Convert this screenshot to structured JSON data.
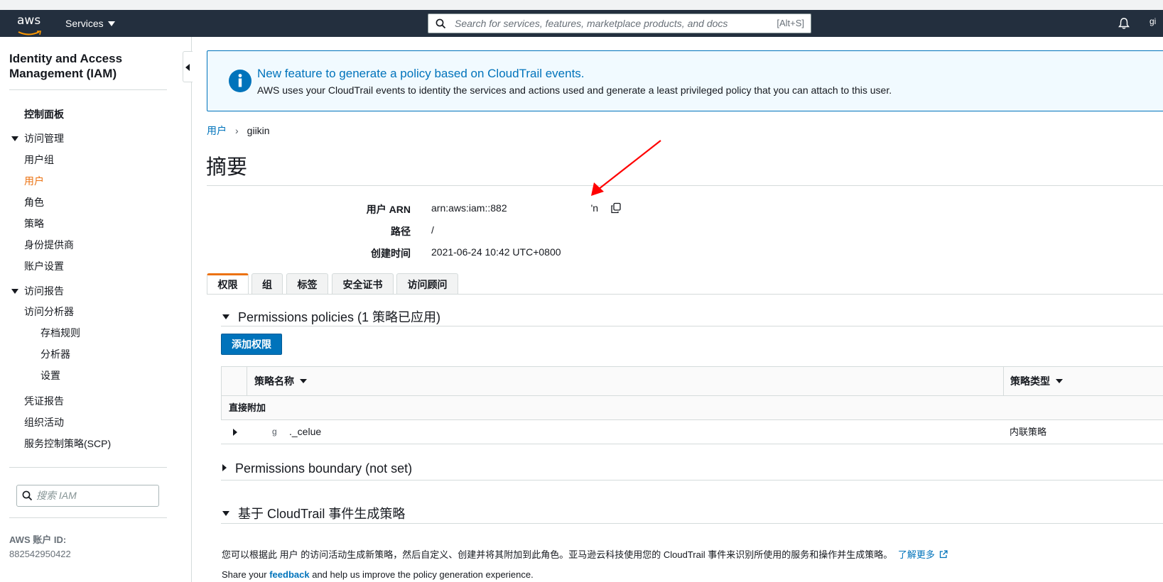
{
  "topnav": {
    "logo_text": "aws",
    "services_label": "Services",
    "search_placeholder": "Search for services, features, marketplace products, and docs",
    "search_shortcut": "[Alt+S]",
    "user_initials": "gi"
  },
  "sidebar": {
    "title": "Identity and Access Management (IAM)",
    "dashboard": "控制面板",
    "access_management": "访问管理",
    "items_am": [
      "用户组",
      "用户",
      "角色",
      "策略",
      "身份提供商",
      "账户设置"
    ],
    "access_reports": "访问报告",
    "access_analyzer": "访问分析器",
    "analyzer_items": [
      "存档规则",
      "分析器",
      "设置"
    ],
    "items_reports": [
      "凭证报告",
      "组织活动",
      "服务控制策略(SCP)"
    ],
    "search_placeholder": "搜索 IAM",
    "account_label": "AWS 账户 ID:",
    "account_id": "882542950422"
  },
  "banner": {
    "heading": "New feature to generate a policy based on CloudTrail events.",
    "body": "AWS uses your CloudTrail events to identity the services and actions used and generate a least privileged policy that you can attach to this user."
  },
  "breadcrumb": {
    "parent": "用户",
    "current": "giikin"
  },
  "summary": {
    "title": "摘要",
    "arn_label": "用户 ARN",
    "arn_value_start": "arn:aws:iam::882",
    "arn_value_end": "'n",
    "path_label": "路径",
    "path_value": "/",
    "created_label": "创建时间",
    "created_value": "2021-06-24 10:42 UTC+0800"
  },
  "tabs": [
    "权限",
    "组",
    "标签",
    "安全证书",
    "访问顾问"
  ],
  "permissions": {
    "heading": "Permissions policies (1 策略已应用)",
    "add_button": "添加权限",
    "col_name": "策略名称",
    "col_type": "策略类型",
    "group_row": "直接附加",
    "policy_name_prefix": "g",
    "policy_name": "._celue",
    "policy_type": "内联策略"
  },
  "boundary": {
    "heading": "Permissions boundary (not set)"
  },
  "cloudtrail": {
    "heading": "基于 CloudTrail 事件生成策略",
    "desc": "您可以根据此 用户 的访问活动生成新策略，然后自定义、创建并将其附加到此角色。亚马逊云科技使用您的 CloudTrail 事件来识别所使用的服务和操作并生成策略。",
    "learn_more": "了解更多",
    "share_pre": "Share your",
    "share_link": "feedback",
    "share_post": "and help us improve the policy generation experience."
  },
  "colors": {
    "nav_bg": "#232f3e",
    "accent": "#ec7211",
    "link": "#0073bb",
    "annotation_arrow": "#ff0000"
  }
}
